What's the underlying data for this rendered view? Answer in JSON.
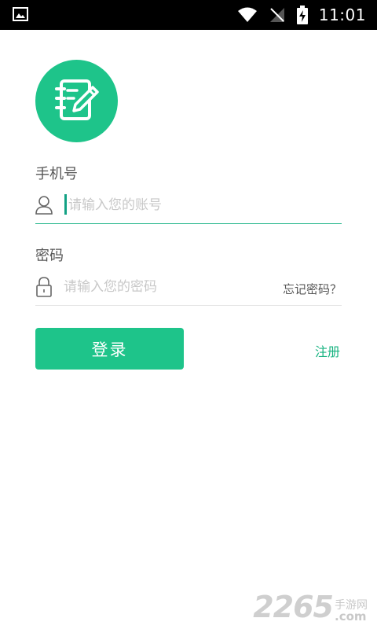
{
  "status_bar": {
    "time": "11:01",
    "icons": [
      "image-notification-icon",
      "wifi-icon",
      "no-signal-icon",
      "battery-charging-icon"
    ]
  },
  "logo": {
    "icon": "notebook-edit-icon",
    "color": "#1ec48a"
  },
  "phone": {
    "label": "手机号",
    "placeholder": "请输入您的账号",
    "icon": "user-icon"
  },
  "password": {
    "label": "密码",
    "placeholder": "请输入您的密码",
    "icon": "lock-icon",
    "forgot": "忘记密码？"
  },
  "actions": {
    "login": "登录",
    "register": "注册"
  },
  "watermark": {
    "number": "2265",
    "chinese": "手游网",
    "suffix": ".com"
  },
  "colors": {
    "accent": "#1ec48a",
    "accent_text": "#17b380",
    "underline_active": "#22b58a"
  }
}
